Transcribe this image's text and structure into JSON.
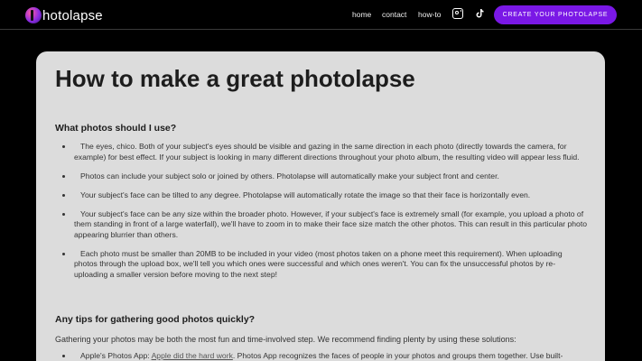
{
  "nav": {
    "logo_text": "hotolapse",
    "links": [
      "home",
      "contact",
      "how-to"
    ],
    "icons": [
      "instagram-icon",
      "tiktok-icon"
    ],
    "cta_label": "CREATE YOUR PHOTOLAPSE",
    "cta_color": "#7a18e6"
  },
  "main": {
    "title": "How to make a great photolapse",
    "section1": {
      "heading": "What photos should I use?",
      "items": [
        "The eyes, chico. Both of your subject's eyes should be visible and gazing in the same direction in each photo (directly towards the camera, for example) for best effect. If your subject is looking in many different directions throughout your photo album, the resulting video will appear less fluid.",
        "Photos can include your subject solo or joined by others. Photolapse will automatically make your subject front and center.",
        "Your subject's face can be tilted to any degree. Photolapse will automatically rotate the image so that their face is horizontally even.",
        "Your subject's face can be any size within the broader photo. However, if your subject's face is extremely small (for example, you upload a photo of them standing in front of a large waterfall), we'll have to zoom in to make their face size match the other photos. This can result in this particular photo appearing blurrier than others.",
        "Each photo must be smaller than 20MB to be included in your video (most photos taken on a phone meet this requirement). When uploading photos through the upload box, we'll tell you which ones were successful and which ones weren't. You can fix the unsuccessful photos by re-uploading a smaller version before moving to the next step!"
      ]
    },
    "section2": {
      "heading": "Any tips for gathering good photos quickly?",
      "intro": "Gathering your photos may be both the most fun and time-involved step. We recommend finding plenty by using these solutions:",
      "item1_prefix": "Apple's Photos App: ",
      "item1_link": "Apple did the hard work",
      "item1_suffix": ". Photos App recognizes the faces of people in your photos and groups them together. Use built-"
    }
  }
}
